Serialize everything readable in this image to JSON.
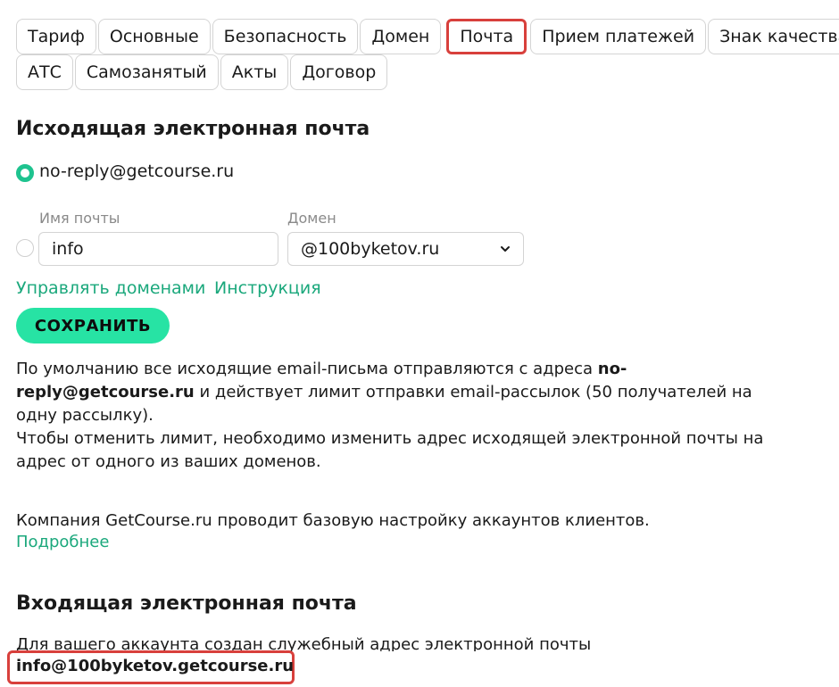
{
  "tabs": {
    "row1": [
      "Тариф",
      "Основные",
      "Безопасность",
      "Домен",
      "Почта",
      "Прием платежей",
      "Знак качества"
    ],
    "row2": [
      "АТС",
      "Самозанятый",
      "Акты",
      "Договор"
    ],
    "active": "Почта"
  },
  "outgoing": {
    "title": "Исходящая электронная почта",
    "default_address": "no-reply@getcourse.ru",
    "mail_name_label": "Имя почты",
    "mail_name_value": "info",
    "domain_label": "Домен",
    "domain_value": "@100byketov.ru",
    "manage_domains_link": "Управлять доменами",
    "instruction_link": "Инструкция",
    "save_label": "СОХРАНИТЬ",
    "desc_part1": "По умолчанию все исходящие email-письма отправляются с адреса ",
    "desc_bold": "no-reply@getcourse.ru",
    "desc_part2": " и действует лимит отправки email-рассылок (50 получателей на одну рассылку).",
    "desc_line2": "Чтобы отменить лимит, необходимо изменить адрес исходящей электронной почты на адрес от одного из ваших доменов.",
    "company_text": "Компания GetCourse.ru проводит базовую настройку аккаунтов клиентов.",
    "more_link": "Подробнее"
  },
  "incoming": {
    "title": "Входящая электронная почта",
    "desc": "Для вашего аккаунта создан служебный адрес электронной почты",
    "service_address": "info@100byketov.getcourse.ru"
  },
  "colors": {
    "accent": "#27e3a4",
    "link": "#1ba87c",
    "highlight": "#d8403c"
  }
}
